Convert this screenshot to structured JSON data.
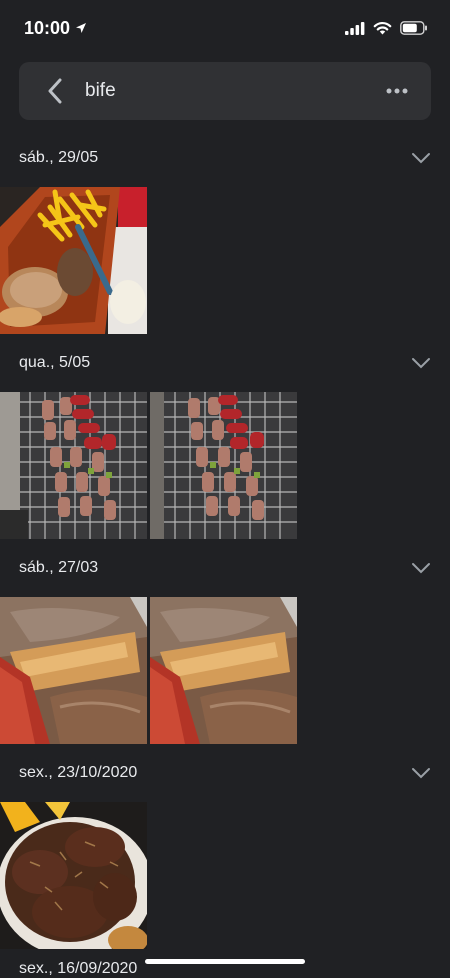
{
  "status_bar": {
    "time": "10:00"
  },
  "search": {
    "query": "bife"
  },
  "sections": [
    {
      "date": "sáb., 29/05",
      "photos": [
        "fries-steak-photo"
      ]
    },
    {
      "date": "qua., 5/05",
      "photos": [
        "skewers-grill-photo-1",
        "skewers-grill-photo-2"
      ]
    },
    {
      "date": "sáb., 27/03",
      "photos": [
        "roast-meat-photo-1",
        "roast-meat-photo-2"
      ]
    },
    {
      "date": "sex., 23/10/2020",
      "photos": [
        "braised-beef-photo"
      ]
    }
  ],
  "partial_section": {
    "date": "sex., 16/09/2020"
  },
  "colors": {
    "background": "#202124",
    "search_bar": "#303134",
    "text": "#e8eaed"
  }
}
